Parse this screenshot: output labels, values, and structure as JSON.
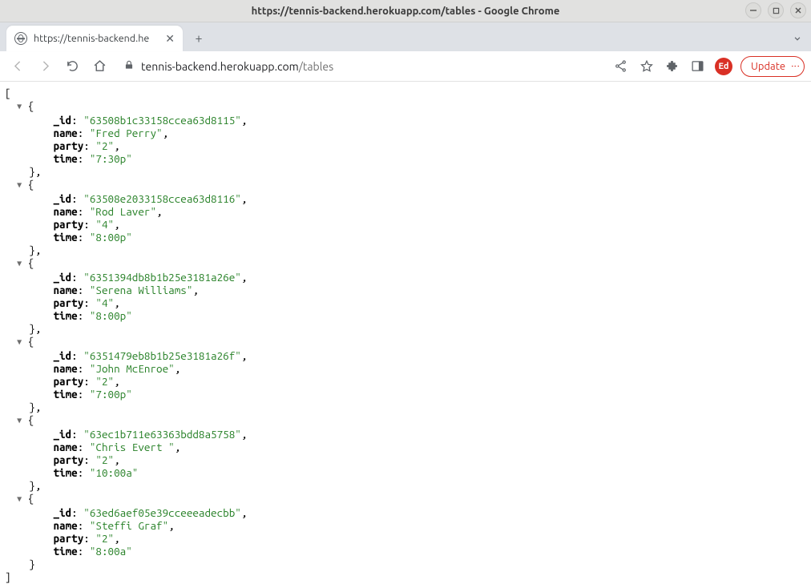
{
  "window": {
    "title": "https://tennis-backend.herokuapp.com/tables - Google Chrome"
  },
  "tab": {
    "label": "https://tennis-backend.he"
  },
  "address": {
    "host": "tennis-backend.herokuapp.com",
    "path": "/tables"
  },
  "avatar": "Ed",
  "update_label": "Update",
  "records": [
    {
      "_id": "63508b1c33158ccea63d8115",
      "name": "Fred Perry",
      "party": "2",
      "time": "7:30p"
    },
    {
      "_id": "63508e2033158ccea63d8116",
      "name": "Rod Laver",
      "party": "4",
      "time": "8:00p"
    },
    {
      "_id": "6351394db8b1b25e3181a26e",
      "name": "Serena Williams",
      "party": "4",
      "time": "8:00p"
    },
    {
      "_id": "6351479eb8b1b25e3181a26f",
      "name": "John McEnroe",
      "party": "2",
      "time": "7:00p"
    },
    {
      "_id": "63ec1b711e63363bdd8a5758",
      "name": "Chris Evert ",
      "party": "2",
      "time": "10:00a"
    },
    {
      "_id": "63ed6aef05e39cceeeadecbb",
      "name": "Steffi Graf",
      "party": "2",
      "time": "8:00a"
    }
  ]
}
